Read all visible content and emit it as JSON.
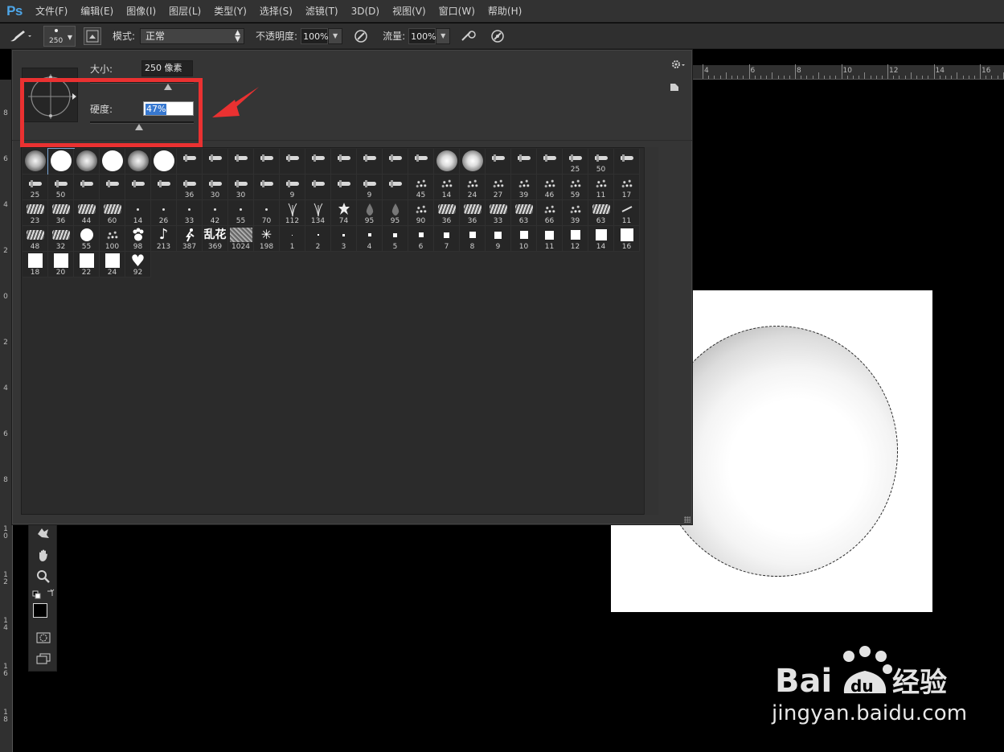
{
  "app": {
    "logo": "Ps"
  },
  "menu": [
    {
      "label": "文件(F)"
    },
    {
      "label": "编辑(E)"
    },
    {
      "label": "图像(I)"
    },
    {
      "label": "图层(L)"
    },
    {
      "label": "类型(Y)"
    },
    {
      "label": "选择(S)"
    },
    {
      "label": "滤镜(T)"
    },
    {
      "label": "3D(D)"
    },
    {
      "label": "视图(V)"
    },
    {
      "label": "窗口(W)"
    },
    {
      "label": "帮助(H)"
    }
  ],
  "options": {
    "brush_size_preset": "250",
    "mode_label": "模式:",
    "mode_value": "正常",
    "opacity_label": "不透明度:",
    "opacity_value": "100%",
    "flow_label": "流量:",
    "flow_value": "100%"
  },
  "brush_panel": {
    "size_label": "大小:",
    "size_value": "250 像素",
    "size_fraction": 0.75,
    "hardness_label": "硬度:",
    "hardness_value": "47%",
    "hardness_fraction": 0.47,
    "presets": [
      {
        "cap": "",
        "kind": "soft"
      },
      {
        "cap": "",
        "kind": "hard",
        "selected": true
      },
      {
        "cap": "",
        "kind": "soft"
      },
      {
        "cap": "",
        "kind": "hard"
      },
      {
        "cap": "",
        "kind": "soft"
      },
      {
        "cap": "",
        "kind": "hard"
      },
      {
        "cap": "",
        "kind": "pen"
      },
      {
        "cap": "",
        "kind": "pen"
      },
      {
        "cap": "",
        "kind": "pen"
      },
      {
        "cap": "",
        "kind": "pen"
      },
      {
        "cap": "",
        "kind": "pen"
      },
      {
        "cap": "",
        "kind": "pen"
      },
      {
        "cap": "",
        "kind": "pen"
      },
      {
        "cap": "",
        "kind": "pen"
      },
      {
        "cap": "",
        "kind": "pen"
      },
      {
        "cap": "",
        "kind": "pen"
      },
      {
        "cap": "",
        "kind": "softs"
      },
      {
        "cap": "",
        "kind": "softs"
      },
      {
        "cap": "",
        "kind": "pen"
      },
      {
        "cap": "",
        "kind": "pen"
      },
      {
        "cap": "",
        "kind": "pen"
      },
      {
        "cap": "25",
        "kind": "pen"
      },
      {
        "cap": "50",
        "kind": "pen"
      },
      {
        "cap": "",
        "kind": "pen"
      },
      {
        "cap": "25",
        "kind": "pen"
      },
      {
        "cap": "50",
        "kind": "pen"
      },
      {
        "cap": "",
        "kind": "pen"
      },
      {
        "cap": "",
        "kind": "pen"
      },
      {
        "cap": "",
        "kind": "pen"
      },
      {
        "cap": "",
        "kind": "pen"
      },
      {
        "cap": "36",
        "kind": "pen"
      },
      {
        "cap": "30",
        "kind": "pen"
      },
      {
        "cap": "30",
        "kind": "pen"
      },
      {
        "cap": "",
        "kind": "pen"
      },
      {
        "cap": "9",
        "kind": "pen"
      },
      {
        "cap": "",
        "kind": "pen"
      },
      {
        "cap": "",
        "kind": "pen"
      },
      {
        "cap": "9",
        "kind": "pen"
      },
      {
        "cap": "",
        "kind": "pen"
      },
      {
        "cap": "45",
        "kind": "spray"
      },
      {
        "cap": "14",
        "kind": "spray"
      },
      {
        "cap": "24",
        "kind": "spray"
      },
      {
        "cap": "27",
        "kind": "spray"
      },
      {
        "cap": "39",
        "kind": "spray"
      },
      {
        "cap": "46",
        "kind": "spray"
      },
      {
        "cap": "59",
        "kind": "spray"
      },
      {
        "cap": "11",
        "kind": "spray"
      },
      {
        "cap": "17",
        "kind": "spray"
      },
      {
        "cap": "23",
        "kind": "chalk"
      },
      {
        "cap": "36",
        "kind": "chalk"
      },
      {
        "cap": "44",
        "kind": "chalk"
      },
      {
        "cap": "60",
        "kind": "chalk"
      },
      {
        "cap": "14",
        "kind": "dot1"
      },
      {
        "cap": "26",
        "kind": "dot1"
      },
      {
        "cap": "33",
        "kind": "dot1"
      },
      {
        "cap": "42",
        "kind": "dot1"
      },
      {
        "cap": "55",
        "kind": "dot1"
      },
      {
        "cap": "70",
        "kind": "dot1"
      },
      {
        "cap": "112",
        "kind": "grass"
      },
      {
        "cap": "134",
        "kind": "grass"
      },
      {
        "cap": "74",
        "kind": "leaf"
      },
      {
        "cap": "95",
        "kind": "drop"
      },
      {
        "cap": "95",
        "kind": "drop"
      },
      {
        "cap": "90",
        "kind": "spray"
      },
      {
        "cap": "36",
        "kind": "chalk"
      },
      {
        "cap": "36",
        "kind": "chalk"
      },
      {
        "cap": "33",
        "kind": "chalk"
      },
      {
        "cap": "63",
        "kind": "chalk"
      },
      {
        "cap": "66",
        "kind": "spray"
      },
      {
        "cap": "39",
        "kind": "spray"
      },
      {
        "cap": "63",
        "kind": "chalk"
      },
      {
        "cap": "11",
        "kind": "stroke"
      },
      {
        "cap": "48",
        "kind": "chalk"
      },
      {
        "cap": "32",
        "kind": "chalk"
      },
      {
        "cap": "55",
        "kind": "circle"
      },
      {
        "cap": "100",
        "kind": "spray"
      },
      {
        "cap": "98",
        "kind": "paw"
      },
      {
        "cap": "213",
        "kind": "note"
      },
      {
        "cap": "387",
        "kind": "figure"
      },
      {
        "cap": "369",
        "kind": "text",
        "text": "乱花"
      },
      {
        "cap": "1024",
        "kind": "tex"
      },
      {
        "cap": "198",
        "kind": "star"
      },
      {
        "cap": "1",
        "kind": "sq",
        "s": 1
      },
      {
        "cap": "2",
        "kind": "sq",
        "s": 2
      },
      {
        "cap": "3",
        "kind": "sq",
        "s": 3
      },
      {
        "cap": "4",
        "kind": "sq",
        "s": 4
      },
      {
        "cap": "5",
        "kind": "sq",
        "s": 5
      },
      {
        "cap": "6",
        "kind": "sq",
        "s": 6
      },
      {
        "cap": "7",
        "kind": "sq",
        "s": 7
      },
      {
        "cap": "8",
        "kind": "sq",
        "s": 8
      },
      {
        "cap": "9",
        "kind": "sq",
        "s": 9
      },
      {
        "cap": "10",
        "kind": "sq",
        "s": 10
      },
      {
        "cap": "11",
        "kind": "sq",
        "s": 11
      },
      {
        "cap": "12",
        "kind": "sq",
        "s": 12
      },
      {
        "cap": "14",
        "kind": "sq",
        "s": 14
      },
      {
        "cap": "16",
        "kind": "sq",
        "s": 16
      },
      {
        "cap": "18",
        "kind": "sq",
        "s": 18
      },
      {
        "cap": "20",
        "kind": "sq",
        "s": 18
      },
      {
        "cap": "22",
        "kind": "sq",
        "s": 18
      },
      {
        "cap": "24",
        "kind": "sq",
        "s": 18
      },
      {
        "cap": "92",
        "kind": "heart"
      }
    ]
  },
  "ruler_top": [
    "4",
    "6",
    "8",
    "10",
    "12",
    "14",
    "16"
  ],
  "ruler_left": [
    "8",
    "6",
    "4",
    "2",
    "0",
    "2",
    "4",
    "6",
    "8",
    "1 0",
    "1 2",
    "1 4",
    "1 6",
    "1 8"
  ],
  "watermark": {
    "domain": "jingyan.baidu.com",
    "logo_text": "Bai du 经验"
  }
}
